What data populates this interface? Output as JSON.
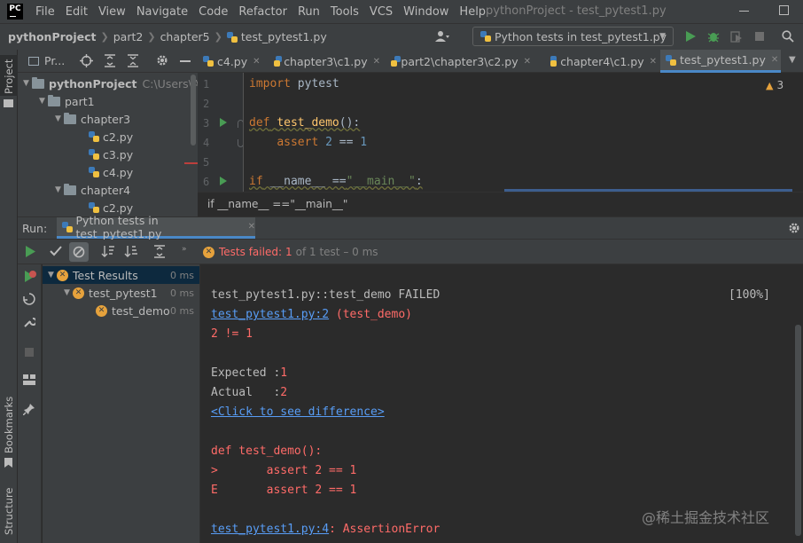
{
  "app": {
    "logo_text": "PC",
    "window_title": "pythonProject - test_pytest1.py"
  },
  "menu": [
    "File",
    "Edit",
    "View",
    "Navigate",
    "Code",
    "Refactor",
    "Run",
    "Tools",
    "VCS",
    "Window",
    "Help"
  ],
  "breadcrumb": {
    "project": "pythonProject",
    "items": [
      "part2",
      "chapter5",
      "test_pytest1.py"
    ]
  },
  "run_config": {
    "label": "Python tests in test_pytest1.py"
  },
  "left_strip": {
    "project_label": "Project",
    "bookmarks_label": "Bookmarks",
    "structure_label": "Structure"
  },
  "project_panel": {
    "title": "Pr...",
    "tree": [
      {
        "label": "pythonProject",
        "suffix": "C:\\Users\\Ac",
        "level": 0,
        "type": "folder",
        "expanded": true
      },
      {
        "label": "part1",
        "level": 1,
        "type": "folder",
        "expanded": true
      },
      {
        "label": "chapter3",
        "level": 2,
        "type": "folder",
        "expanded": true
      },
      {
        "label": "c2.py",
        "level": 3,
        "type": "file"
      },
      {
        "label": "c3.py",
        "level": 3,
        "type": "file"
      },
      {
        "label": "c4.py",
        "level": 3,
        "type": "file"
      },
      {
        "label": "chapter4",
        "level": 2,
        "type": "folder",
        "expanded": true
      },
      {
        "label": "c2.py",
        "level": 3,
        "type": "file"
      }
    ]
  },
  "editor_tabs": [
    {
      "label": "c4.py",
      "active": false
    },
    {
      "label": "chapter3\\c1.py",
      "active": false
    },
    {
      "label": "part2\\chapter3\\c2.py",
      "active": false
    },
    {
      "label": "chapter4\\c1.py",
      "active": false
    },
    {
      "label": "test_pytest1.py",
      "active": true
    }
  ],
  "editor": {
    "warning_count": "3",
    "line_numbers": [
      "1",
      "2",
      "3",
      "4",
      "5",
      "6"
    ],
    "lines": {
      "l1_kw": "import",
      "l1_rest": " pytest",
      "l3_kw": "def",
      "l3_fn": "test_demo",
      "l3_rest": "():",
      "l4_kw": "assert",
      "l4_num1": "2",
      "l4_op": " == ",
      "l4_num2": "1",
      "l6_kw": "if",
      "l6_mid": " __name__ ==",
      "l6_str": "\"__main__\"",
      "l6_end": ":"
    },
    "breadcrumb": "if __name__ ==\"__main__\""
  },
  "run_window": {
    "label": "Run:",
    "tab_label": "Python tests in test_pytest1.py",
    "status_failed": "Tests failed:",
    "status_failed_count": "1",
    "status_rest": "of 1 test – 0 ms",
    "test_tree": [
      {
        "label": "Test Results",
        "time": "0 ms",
        "level": 0
      },
      {
        "label": "test_pytest1",
        "time": "0 ms",
        "level": 1
      },
      {
        "label": "test_demo",
        "time": "0 ms",
        "level": 2
      }
    ]
  },
  "console": {
    "line1": "test_pytest1.py::test_demo FAILED",
    "progress": "[100%]",
    "link1": "test_pytest1.py:2",
    "link1_rest": " (test_demo)",
    "cmp": "2 != 1",
    "expected_label": "Expected :",
    "expected_value": "1",
    "actual_label": "Actual   :",
    "actual_value": "2",
    "diff_link": "<Click to see difference>",
    "def_line": "def test_demo():",
    "assert_marker": ">       assert 2 == 1",
    "assert_e": "E       assert 2 == 1",
    "link2": "test_pytest1.py:4",
    "link2_rest": ": AssertionError"
  },
  "watermark": "@稀土掘金技术社区",
  "colors": {
    "error_red": "#ff6b68",
    "link_blue": "#589df6",
    "run_green": "#499c54",
    "fail_orange": "#e6a23c"
  }
}
